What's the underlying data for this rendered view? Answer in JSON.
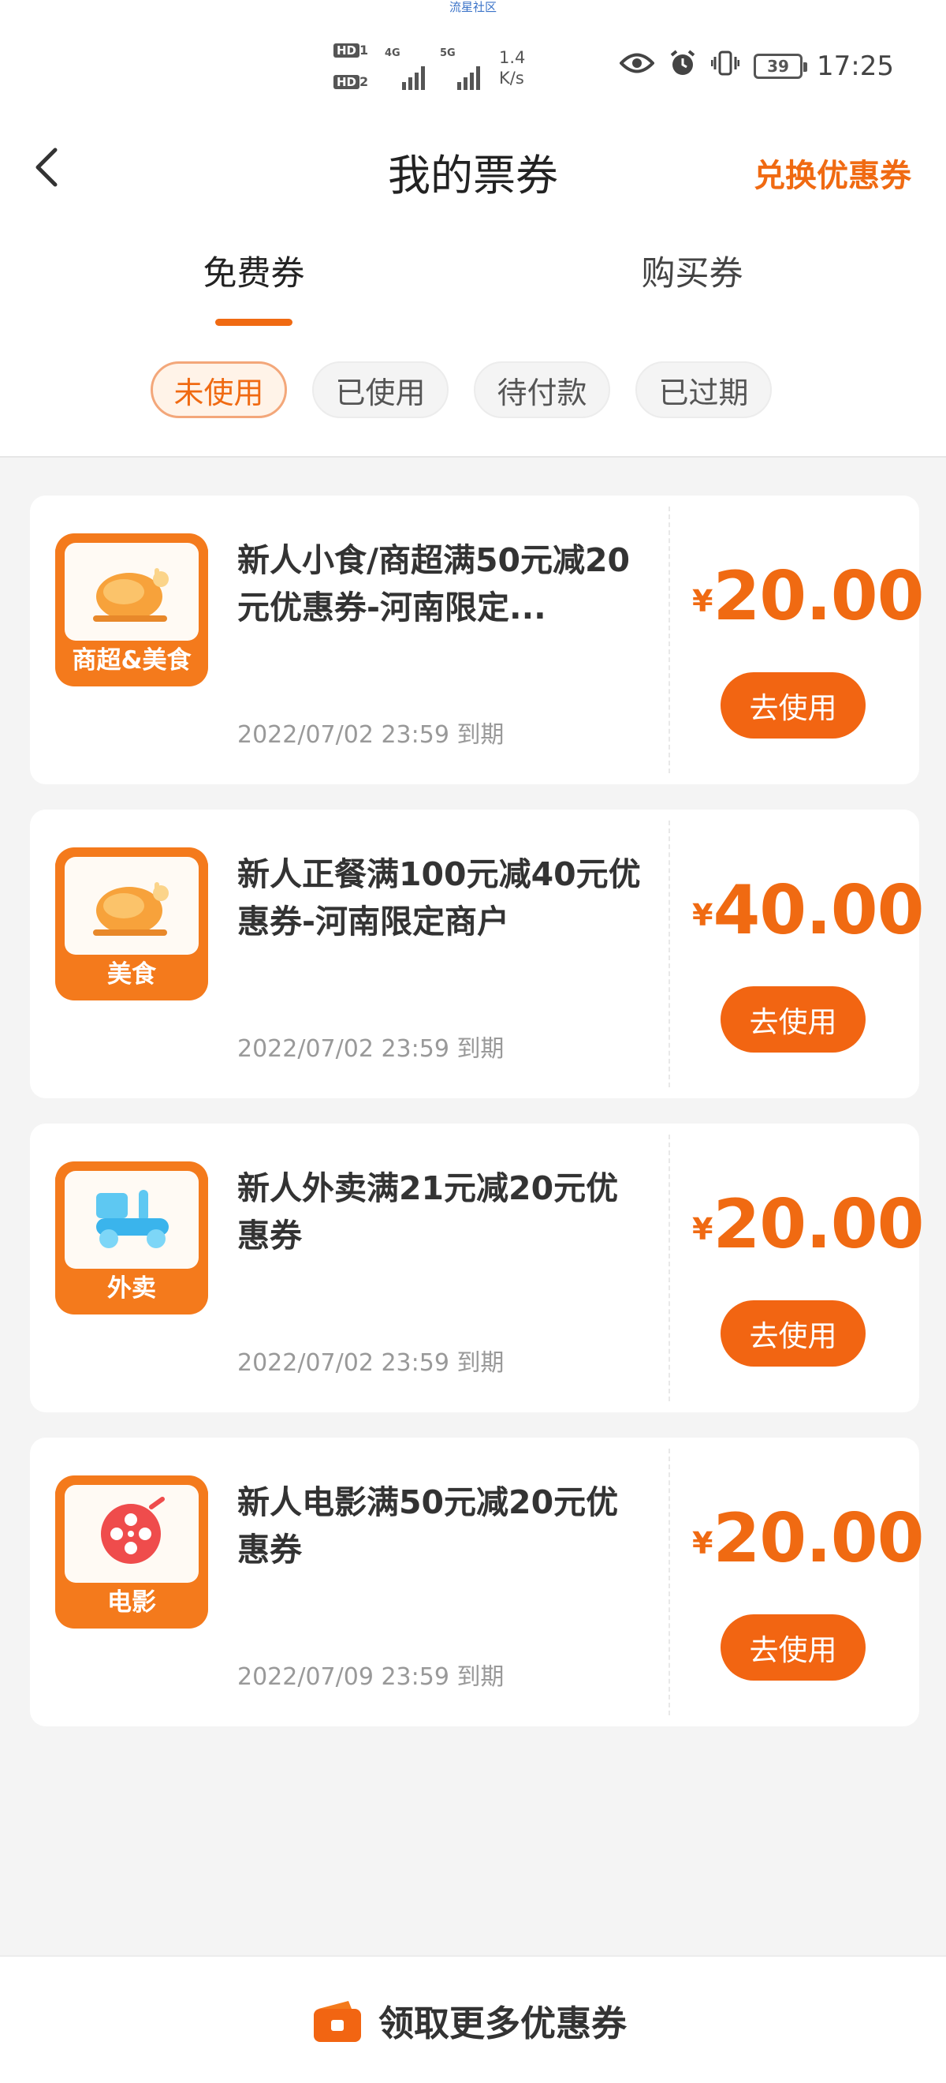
{
  "watermark": "流星社区",
  "status_bar": {
    "sim1": "HD",
    "sim1_num": "1",
    "sim2": "HD",
    "sim2_num": "2",
    "net1": "4G",
    "net2": "5G",
    "speed_value": "1.4",
    "speed_unit": "K/s",
    "battery": "39",
    "time": "17:25",
    "icons": [
      "eye-icon",
      "alarm-icon",
      "vibrate-icon",
      "battery-icon"
    ]
  },
  "header": {
    "title": "我的票券",
    "action": "兑换优惠券"
  },
  "tabs": [
    {
      "label": "免费券",
      "active": true
    },
    {
      "label": "购买券",
      "active": false
    }
  ],
  "filters": [
    {
      "label": "未使用",
      "active": true
    },
    {
      "label": "已使用",
      "active": false
    },
    {
      "label": "待付款",
      "active": false
    },
    {
      "label": "已过期",
      "active": false
    }
  ],
  "coupons": [
    {
      "category": "商超&美食",
      "icon": "roast-chicken-icon",
      "title": "新人小食/商超满50元减20元优惠券-河南限定...",
      "expiry": "2022/07/02 23:59 到期",
      "currency": "¥",
      "amount": "20.00",
      "button": "去使用"
    },
    {
      "category": "美食",
      "icon": "roast-chicken-icon",
      "title": "新人正餐满100元减40元优惠券-河南限定商户",
      "expiry": "2022/07/02 23:59 到期",
      "currency": "¥",
      "amount": "40.00",
      "button": "去使用"
    },
    {
      "category": "外卖",
      "icon": "scooter-icon",
      "title": "新人外卖满21元减20元优惠券",
      "expiry": "2022/07/02 23:59 到期",
      "currency": "¥",
      "amount": "20.00",
      "button": "去使用"
    },
    {
      "category": "电影",
      "icon": "film-reel-icon",
      "title": "新人电影满50元减20元优惠券",
      "expiry": "2022/07/09 23:59 到期",
      "currency": "¥",
      "amount": "20.00",
      "button": "去使用"
    }
  ],
  "bottom": {
    "label": "领取更多优惠券",
    "icon": "coupon-bag-icon"
  },
  "colors": {
    "accent": "#f06a12",
    "button": "#f26512",
    "background": "#f4f4f4"
  }
}
